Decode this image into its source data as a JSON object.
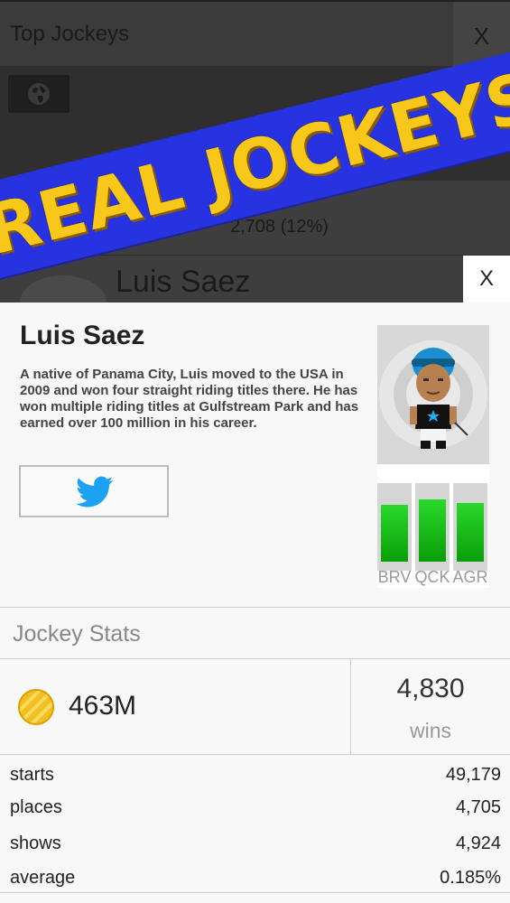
{
  "background": {
    "title": "Top Jockeys",
    "close_label": "X",
    "row_text": "2,708 (12%)",
    "jockey_name": "Luis Saez"
  },
  "banner": {
    "text": "REAL JOCKEYS",
    "color": "#f7c71a",
    "bg": "#2732e0"
  },
  "modal": {
    "close_label": "X",
    "name": "Luis Saez",
    "bio": "A native of Panama City, Luis moved to the USA in 2009 and won four straight riding titles there. He has won multiple riding titles at Gulfstream Park and has earned over 100 million in his career.",
    "twitter_icon": "twitter-icon",
    "attributes": [
      {
        "label": "BRV",
        "value": 0.72
      },
      {
        "label": "QCK",
        "value": 0.79
      },
      {
        "label": "AGR",
        "value": 0.75
      }
    ],
    "stats_title": "Jockey Stats",
    "earnings": "463M",
    "wins_value": "4,830",
    "wins_label": "wins",
    "rows": [
      {
        "label": "starts",
        "value": "49,179"
      },
      {
        "label": "places",
        "value": "4,705"
      },
      {
        "label": "shows",
        "value": "4,924"
      },
      {
        "label": "average",
        "value": "0.185%"
      }
    ]
  }
}
